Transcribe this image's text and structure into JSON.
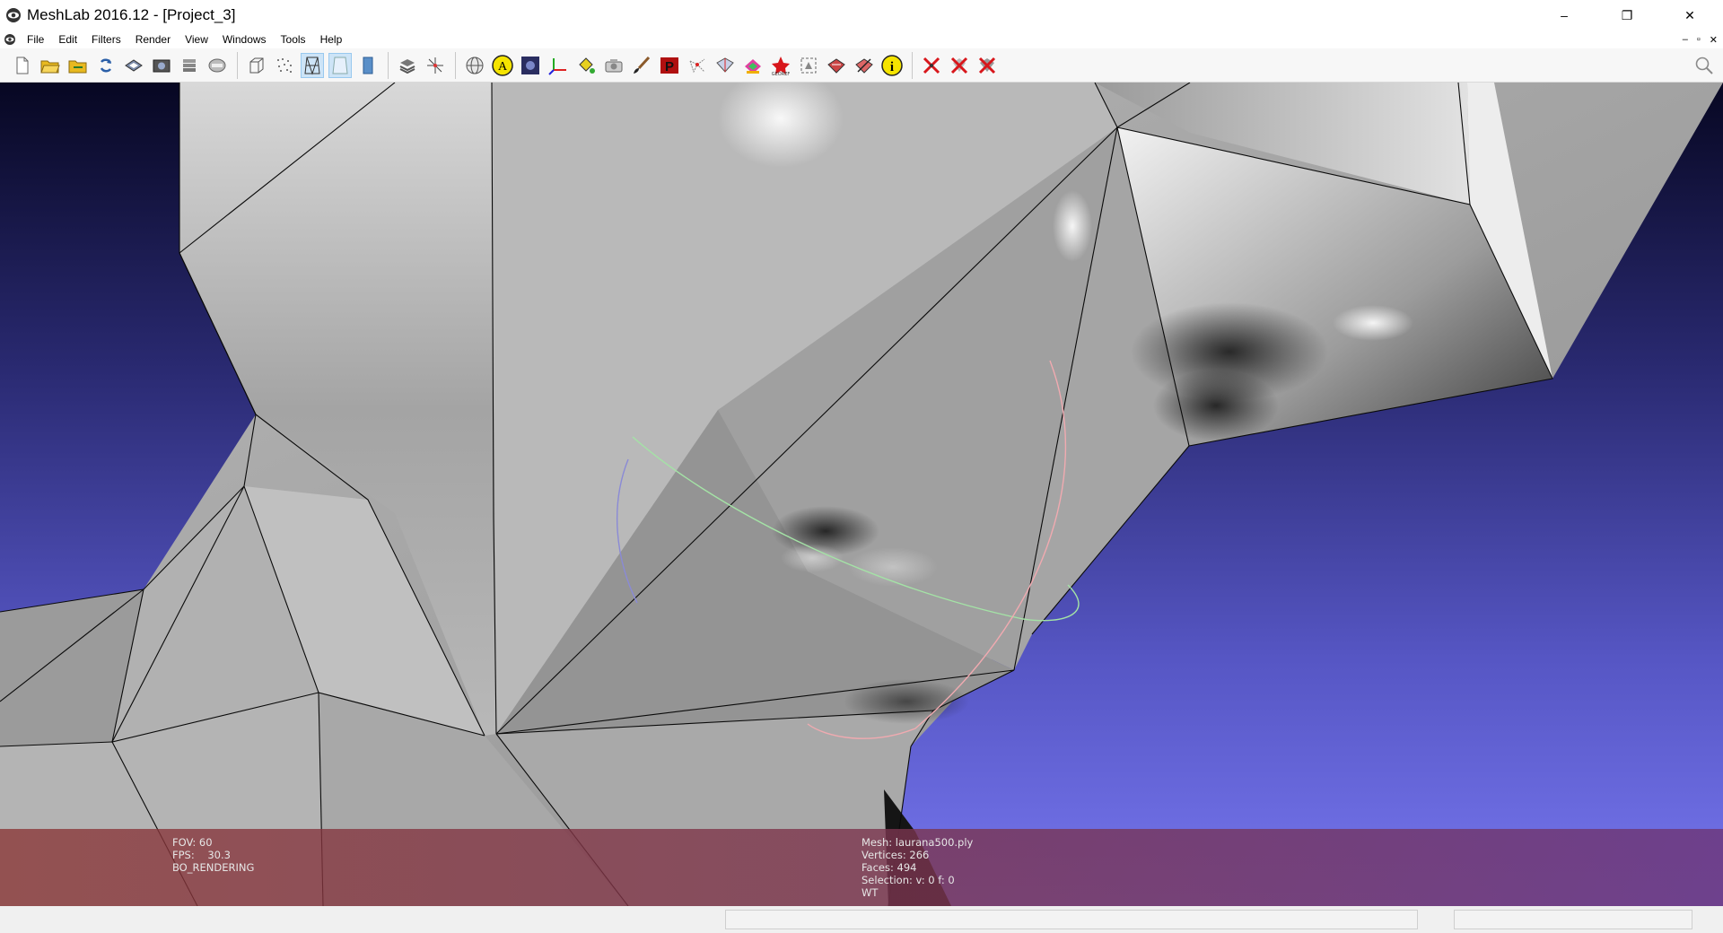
{
  "window": {
    "title": "MeshLab 2016.12 - [Project_3]",
    "minimize": "–",
    "restore": "❐",
    "close": "✕"
  },
  "menu": {
    "items": [
      "File",
      "Edit",
      "Filters",
      "Render",
      "View",
      "Windows",
      "Tools",
      "Help"
    ],
    "mdi": [
      "–",
      "▫",
      "✕"
    ]
  },
  "toolbar": {
    "buttons": [
      {
        "name": "new-project-icon"
      },
      {
        "name": "open-project-icon"
      },
      {
        "name": "import-mesh-icon"
      },
      {
        "name": "reload-icon"
      },
      {
        "name": "export-mesh-icon"
      },
      {
        "name": "snapshot-icon"
      },
      {
        "name": "layers-icon"
      },
      {
        "name": "raster-icon"
      },
      {
        "name": "bounding-box-icon"
      },
      {
        "name": "points-icon"
      },
      {
        "name": "wireframe-icon",
        "active": true
      },
      {
        "name": "flat-shading-icon",
        "active": true
      },
      {
        "name": "smooth-shading-icon"
      },
      {
        "name": "layer-dialog-icon"
      },
      {
        "name": "trackball-icon"
      },
      {
        "name": "globe-icon"
      },
      {
        "name": "annotation-a-icon"
      },
      {
        "name": "shader-icon"
      },
      {
        "name": "axes-icon"
      },
      {
        "name": "paint-bucket-icon"
      },
      {
        "name": "camera-icon"
      },
      {
        "name": "brush-icon"
      },
      {
        "name": "pick-points-icon"
      },
      {
        "name": "select-vertices-icon"
      },
      {
        "name": "select-faces-icon"
      },
      {
        "name": "color-paint-icon"
      },
      {
        "name": "georef-icon"
      },
      {
        "name": "select-connected-icon"
      },
      {
        "name": "align-icon"
      },
      {
        "name": "measure-icon"
      },
      {
        "name": "info-icon"
      },
      {
        "name": "delete-vertices-icon"
      },
      {
        "name": "delete-faces-icon"
      },
      {
        "name": "delete-all-icon"
      }
    ],
    "colors": {
      "active_bg": "#cde4f7",
      "yellow": "#f5e400",
      "red": "#d8161b"
    }
  },
  "viewport": {
    "background_top": "#070722",
    "background_bottom": "#7272ec",
    "overlay_left_color": "#7a2d2d",
    "overlay_right_color": "#6b3a7d",
    "info_left": [
      "FOV: 60",
      "FPS:    30.3",
      "BO_RENDERING"
    ],
    "info_right": [
      "Mesh: laurana500.ply",
      "Vertices: 266",
      "Faces: 494",
      "Selection: v: 0 f: 0",
      "WT"
    ]
  }
}
